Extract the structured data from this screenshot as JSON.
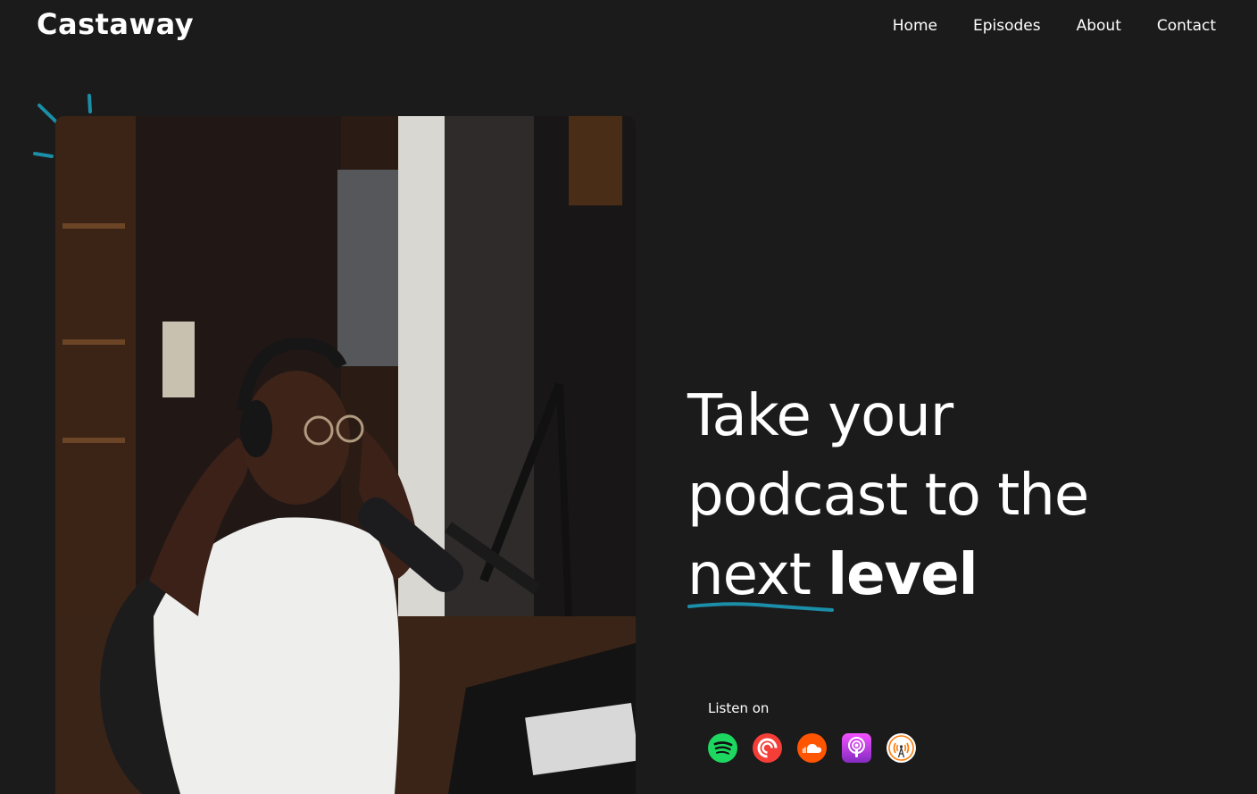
{
  "header": {
    "logo": "Castaway",
    "nav": [
      {
        "label": "Home"
      },
      {
        "label": "Episodes"
      },
      {
        "label": "About"
      },
      {
        "label": "Contact"
      }
    ]
  },
  "hero": {
    "title_line1": "Take your",
    "title_line2": "podcast to the",
    "title_next": "next",
    "title_level": "level",
    "listen_label": "Listen on"
  },
  "platforms": [
    {
      "name": "spotify-icon",
      "color": "#1ed760"
    },
    {
      "name": "pocket-casts-icon",
      "color": "#f43e37"
    },
    {
      "name": "soundcloud-icon",
      "color": "#ff5500"
    },
    {
      "name": "apple-podcasts-icon",
      "color": "#9b3ef0"
    },
    {
      "name": "overcast-icon",
      "color": "#fc7e0f"
    }
  ],
  "colors": {
    "background": "#1c1b1b",
    "accent": "#1b8ea8",
    "text": "#ffffff"
  }
}
